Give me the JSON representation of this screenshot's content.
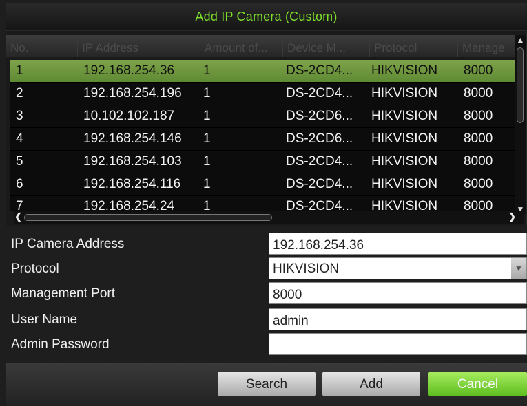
{
  "dialog": {
    "title": "Add IP Camera (Custom)"
  },
  "table": {
    "columns": [
      "No.",
      "IP Address",
      "Amount of...",
      "Device M...",
      "Protocol",
      "Manage"
    ],
    "rows": [
      {
        "no": "1",
        "ip": "192.168.254.36",
        "amount": "1",
        "device": "DS-2CD4...",
        "protocol": "HIKVISION",
        "port": "8000",
        "selected": true
      },
      {
        "no": "2",
        "ip": "192.168.254.196",
        "amount": "1",
        "device": "DS-2CD4...",
        "protocol": "HIKVISION",
        "port": "8000"
      },
      {
        "no": "3",
        "ip": "10.102.102.187",
        "amount": "1",
        "device": "DS-2CD6...",
        "protocol": "HIKVISION",
        "port": "8000"
      },
      {
        "no": "4",
        "ip": "192.168.254.146",
        "amount": "1",
        "device": "DS-2CD6...",
        "protocol": "HIKVISION",
        "port": "8000"
      },
      {
        "no": "5",
        "ip": "192.168.254.103",
        "amount": "1",
        "device": "DS-2CD4...",
        "protocol": "HIKVISION",
        "port": "8000"
      },
      {
        "no": "6",
        "ip": "192.168.254.116",
        "amount": "1",
        "device": "DS-2CD4...",
        "protocol": "HIKVISION",
        "port": "8000"
      },
      {
        "no": "7",
        "ip": "192.168.254.24",
        "amount": "1",
        "device": "DS-2CD4...",
        "protocol": "HIKVISION",
        "port": "8000"
      }
    ]
  },
  "form": {
    "ip_label": "IP Camera Address",
    "ip_value": "192.168.254.36",
    "protocol_label": "Protocol",
    "protocol_value": "HIKVISION",
    "port_label": "Management Port",
    "port_value": "8000",
    "user_label": "User Name",
    "user_value": "admin",
    "password_label": "Admin Password",
    "password_value": ""
  },
  "buttons": {
    "search": "Search",
    "add": "Add",
    "cancel": "Cancel"
  },
  "icons": {
    "scroll_up": "chevron-up-icon",
    "scroll_down": "chevron-down-icon",
    "scroll_left": "chevron-left-icon",
    "scroll_right": "chevron-right-icon",
    "dropdown": "dropdown-arrow-icon"
  },
  "colors": {
    "accent": "#7fe02c",
    "selected_row": "#6f9740",
    "cancel_button": "#6cc42a"
  }
}
